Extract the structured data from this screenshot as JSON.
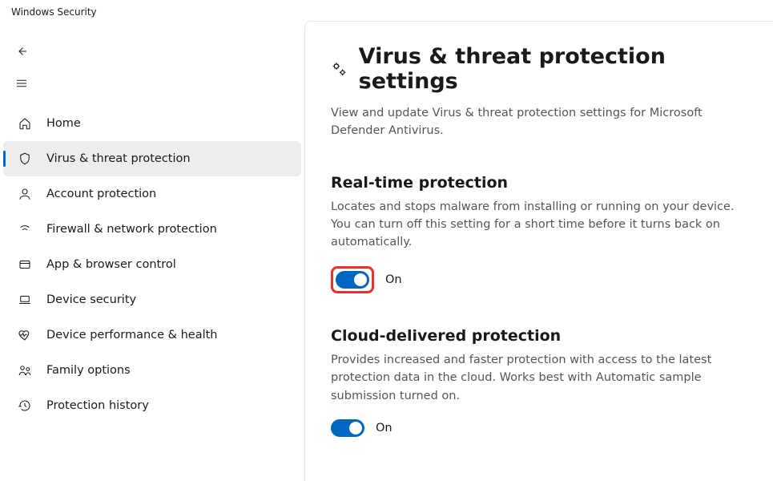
{
  "window": {
    "title": "Windows Security"
  },
  "sidebar": {
    "items": [
      {
        "label": "Home"
      },
      {
        "label": "Virus & threat protection"
      },
      {
        "label": "Account protection"
      },
      {
        "label": "Firewall & network protection"
      },
      {
        "label": "App & browser control"
      },
      {
        "label": "Device security"
      },
      {
        "label": "Device performance & health"
      },
      {
        "label": "Family options"
      },
      {
        "label": "Protection history"
      }
    ]
  },
  "page": {
    "title": "Virus & threat protection settings",
    "subtitle": "View and update Virus & threat protection settings for Microsoft Defender Antivirus."
  },
  "sections": {
    "realtime": {
      "title": "Real-time protection",
      "desc": "Locates and stops malware from installing or running on your device. You can turn off this setting for a short time before it turns back on automatically.",
      "state": "On"
    },
    "cloud": {
      "title": "Cloud-delivered protection",
      "desc": "Provides increased and faster protection with access to the latest protection data in the cloud. Works best with Automatic sample submission turned on.",
      "state": "On"
    }
  },
  "colors": {
    "accent": "#0067c0",
    "highlight": "#e9302a"
  }
}
